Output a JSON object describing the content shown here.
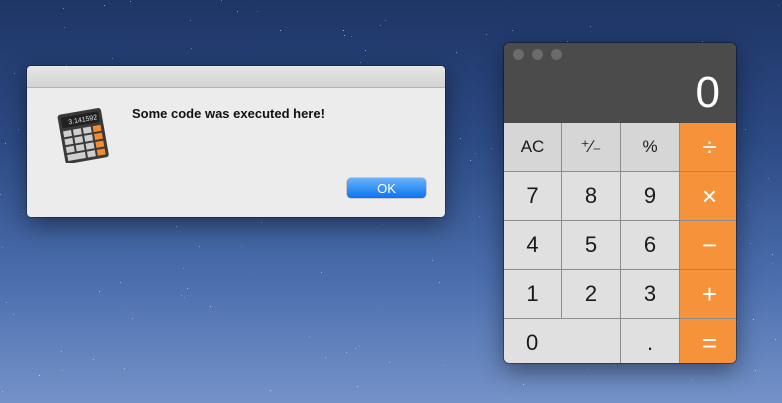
{
  "alert": {
    "icon": "calculator-app-icon",
    "icon_display_text": "3.141592",
    "message": "Some code was executed here!",
    "ok_label": "OK"
  },
  "calculator": {
    "display_value": "0",
    "rows": [
      [
        {
          "label": "AC",
          "kind": "fn",
          "name": "clear-button"
        },
        {
          "label": "⁺∕₋",
          "kind": "fn",
          "name": "plus-minus-button"
        },
        {
          "label": "%",
          "kind": "fn",
          "name": "percent-button"
        },
        {
          "label": "÷",
          "kind": "op",
          "name": "divide-button"
        }
      ],
      [
        {
          "label": "7",
          "kind": "num",
          "name": "digit-7-button"
        },
        {
          "label": "8",
          "kind": "num",
          "name": "digit-8-button"
        },
        {
          "label": "9",
          "kind": "num",
          "name": "digit-9-button"
        },
        {
          "label": "×",
          "kind": "op",
          "name": "multiply-button"
        }
      ],
      [
        {
          "label": "4",
          "kind": "num",
          "name": "digit-4-button"
        },
        {
          "label": "5",
          "kind": "num",
          "name": "digit-5-button"
        },
        {
          "label": "6",
          "kind": "num",
          "name": "digit-6-button"
        },
        {
          "label": "−",
          "kind": "op",
          "name": "subtract-button"
        }
      ],
      [
        {
          "label": "1",
          "kind": "num",
          "name": "digit-1-button"
        },
        {
          "label": "2",
          "kind": "num",
          "name": "digit-2-button"
        },
        {
          "label": "3",
          "kind": "num",
          "name": "digit-3-button"
        },
        {
          "label": "+",
          "kind": "op",
          "name": "add-button"
        }
      ],
      [
        {
          "label": "0",
          "kind": "zero",
          "name": "digit-0-button"
        },
        {
          "label": ".",
          "kind": "num",
          "name": "decimal-button"
        },
        {
          "label": "=",
          "kind": "op",
          "name": "equals-button"
        }
      ]
    ],
    "colors": {
      "operator": "#f6923a",
      "function": "#d6d6d6",
      "digit": "#e0e0e0",
      "display": "#4b4b4b"
    }
  }
}
